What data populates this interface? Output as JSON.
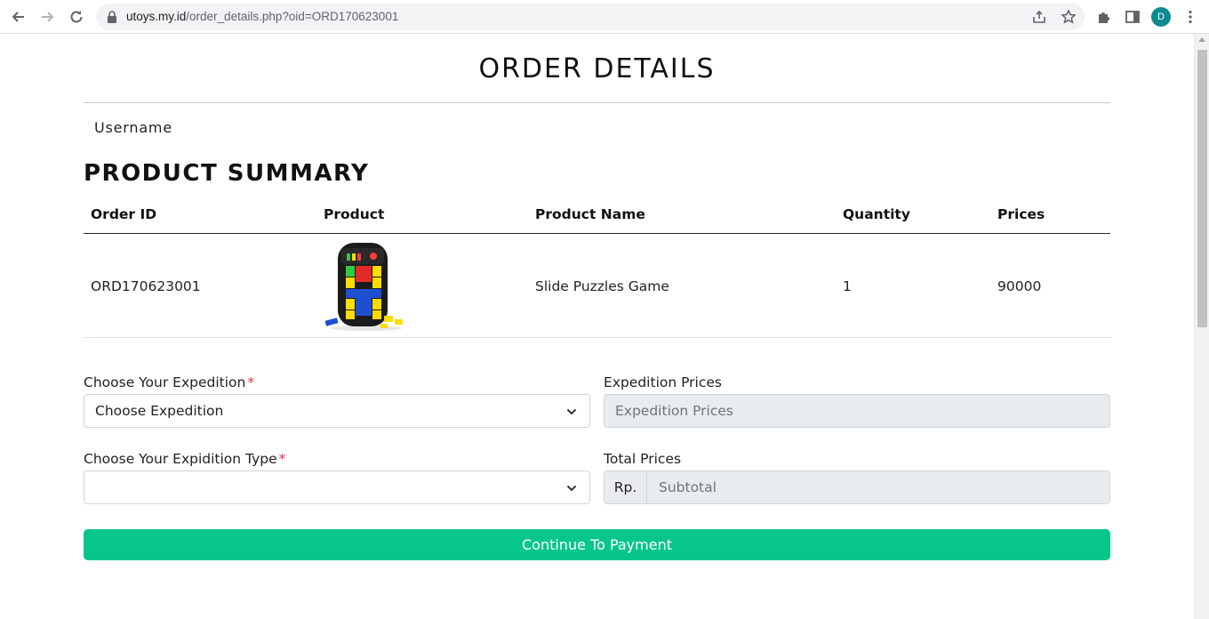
{
  "browser": {
    "url_host": "utoys.my.id",
    "url_path": "/order_details.php?oid=ORD170623001",
    "avatar_letter": "D"
  },
  "page": {
    "title": "ORDER DETAILS",
    "username_label": "Username",
    "summary_title": "PRODUCT SUMMARY"
  },
  "table": {
    "headers": [
      "Order ID",
      "Product",
      "Product Name",
      "Quantity",
      "Prices"
    ],
    "rows": [
      {
        "order_id": "ORD170623001",
        "product_name": "Slide Puzzles Game",
        "quantity": "1",
        "price": "90000"
      }
    ]
  },
  "form": {
    "expedition_label": "Choose Your Expedition",
    "expedition_value": "Choose Expedition",
    "expedition_type_label": "Choose Your Expidition Type",
    "expedition_type_value": "",
    "expedition_prices_label": "Expedition Prices",
    "expedition_prices_placeholder": "Expedition Prices",
    "total_prices_label": "Total Prices",
    "currency": "Rp.",
    "subtotal_placeholder": "Subtotal",
    "required_mark": "*"
  },
  "button": {
    "continue_label": "Continue To Payment"
  },
  "colors": {
    "accent": "#06c789",
    "required": "#dc3545",
    "readonly_bg": "#e9ecef"
  }
}
